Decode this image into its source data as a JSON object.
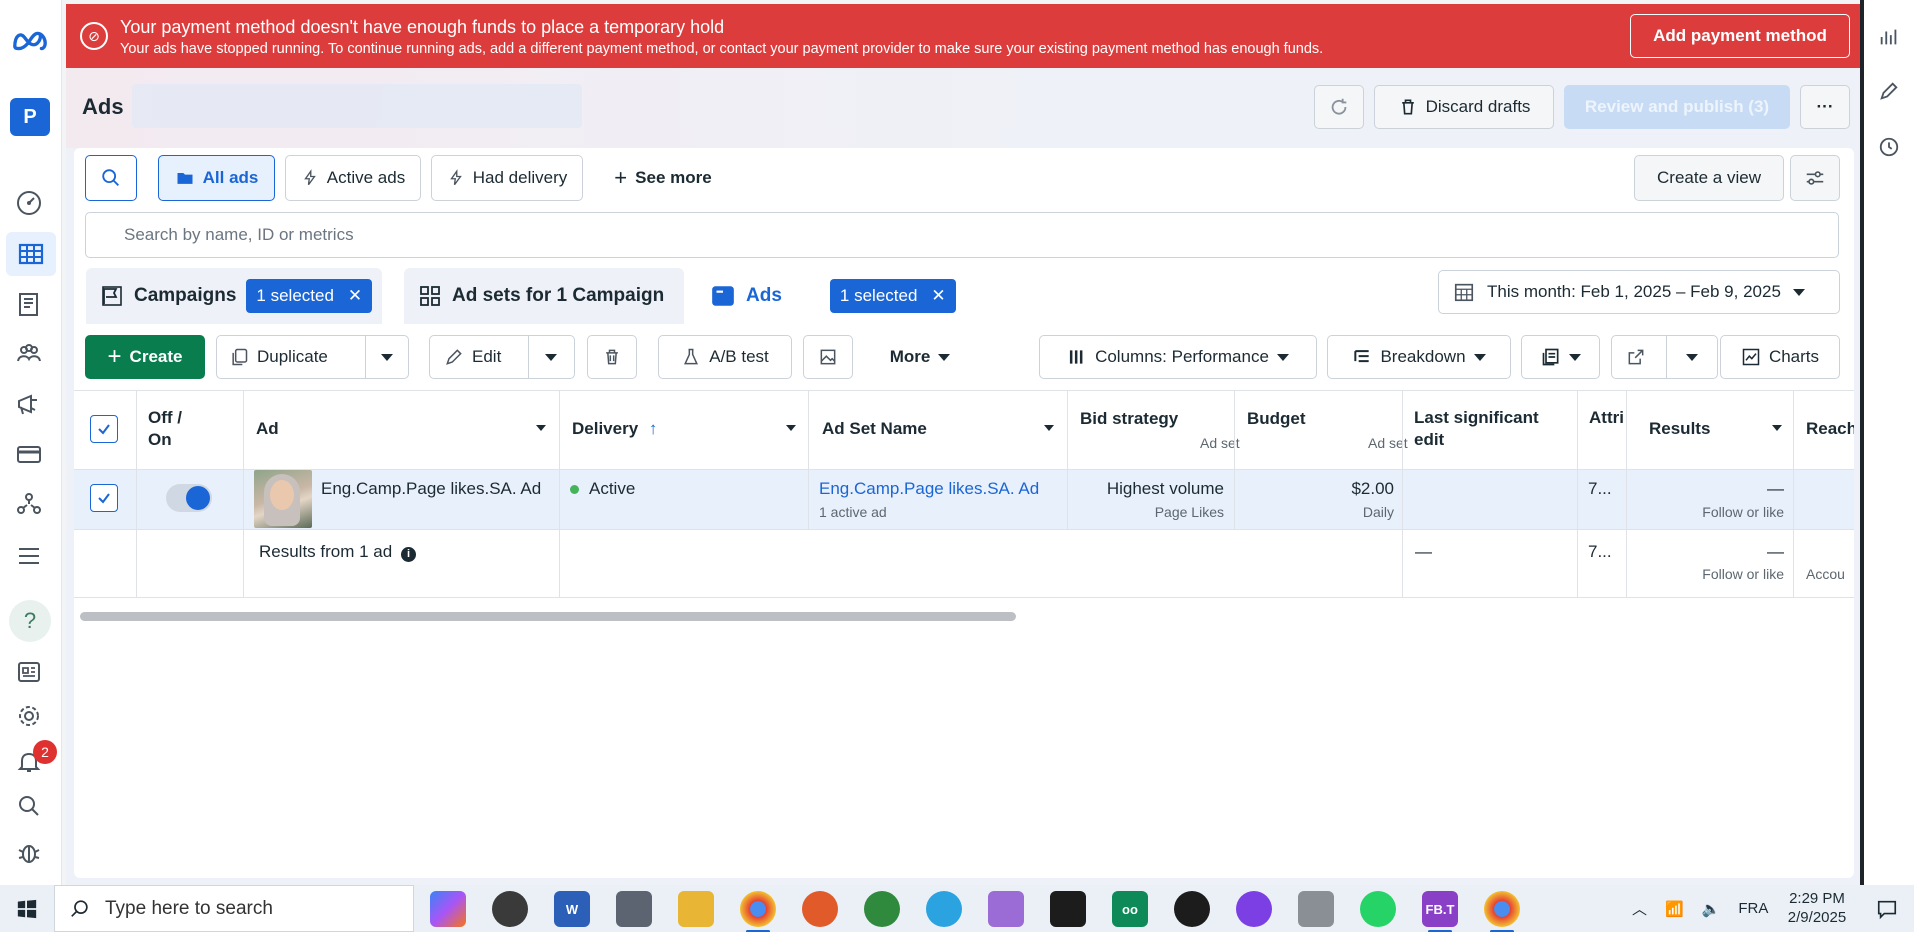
{
  "colors": {
    "brand_blue": "#1a66d6",
    "alert_red": "#dd3c3c",
    "create_green": "#0a7d4f",
    "active_green": "#44b35a",
    "badge_red": "#e03131"
  },
  "alert": {
    "title": "Your payment method doesn't have enough funds to place a temporary hold",
    "body": "Your ads have stopped running. To continue running ads, add a different payment method, or contact your payment provider to make sure your existing payment method has enough funds.",
    "button": "Add payment method"
  },
  "left_rail": {
    "account_initial": "P",
    "help_label": "?",
    "notification_count": "2"
  },
  "header": {
    "title": "Ads",
    "discard_label": "Discard drafts",
    "publish_label": "Review and publish (3)",
    "more_label": "···"
  },
  "filters": {
    "all_ads": "All ads",
    "active_ads": "Active ads",
    "had_delivery": "Had delivery",
    "see_more": "See more",
    "create_view": "Create a view"
  },
  "search": {
    "placeholder": "Search by name, ID or metrics"
  },
  "tabs": {
    "campaigns": "Campaigns",
    "campaigns_badge": "1 selected",
    "adsets": "Ad sets for 1 Campaign",
    "ads": "Ads",
    "ads_badge": "1 selected"
  },
  "date_range": "This month: Feb 1, 2025 – Feb 9, 2025",
  "toolbar": {
    "create": "Create",
    "duplicate": "Duplicate",
    "edit": "Edit",
    "ab_test": "A/B test",
    "more": "More",
    "columns": "Columns: Performance",
    "breakdown": "Breakdown",
    "charts": "Charts"
  },
  "table": {
    "headers": {
      "off_on": "Off / On",
      "ad": "Ad",
      "delivery": "Delivery",
      "delivery_sort": "↑",
      "ad_set_name": "Ad Set Name",
      "bid_strategy": "Bid strategy",
      "bid_strategy_sub": "Ad set",
      "budget": "Budget",
      "budget_sub": "Ad set",
      "last_edit": "Last significant edit",
      "attribution": "Attri sett",
      "results": "Results",
      "reach": "Reach"
    },
    "row": {
      "ad_name": "Eng.Camp.Page likes.SA. Ad",
      "delivery": "Active",
      "ad_set_name": "Eng.Camp.Page likes.SA. Ad s...",
      "ad_set_sub": "1 active ad",
      "bid_strategy": "Highest volume",
      "bid_strategy_sub": "Page Likes",
      "budget": "$2.00",
      "budget_sub": "Daily",
      "attribution": "7...",
      "results": "—",
      "results_sub": "Follow or like"
    },
    "summary": {
      "label": "Results from 1 ad",
      "last_edit": "—",
      "attribution": "7...",
      "results": "—",
      "results_sub": "Follow or like",
      "reach_sub": "Accou"
    }
  },
  "taskbar": {
    "search_placeholder": "Type here to search",
    "fb_label": "FB.T",
    "language": "FRA",
    "time": "2:29 PM",
    "date": "2/9/2025"
  }
}
